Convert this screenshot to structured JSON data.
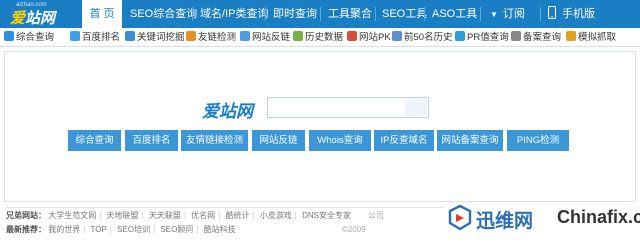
{
  "brand": {
    "domain": "aizhan.com",
    "name_part1": "爱",
    "name_part2": "站网"
  },
  "nav": {
    "home": "首 页",
    "items": [
      "SEO综合查询",
      "域名/IP类查询",
      "即时查询",
      "工具聚合",
      "SEO工具",
      "ASO工具"
    ],
    "subscribe": "订阅",
    "mobile": "手机版"
  },
  "tools": [
    {
      "label": "综合查询",
      "color": "#2d8fe0"
    },
    {
      "label": "百度排名",
      "color": "#3aa0e8"
    },
    {
      "label": "关键词挖掘",
      "color": "#3b8fd6"
    },
    {
      "label": "友链检测",
      "color": "#e3932c"
    },
    {
      "label": "网站反链",
      "color": "#4d9de0"
    },
    {
      "label": "历史数据",
      "color": "#7bb142"
    },
    {
      "label": "网站PK",
      "color": "#d84e3c"
    },
    {
      "label": "前50名历史",
      "color": "#5a8fd0"
    },
    {
      "label": "PR值查询",
      "color": "#2f9cd6"
    },
    {
      "label": "备案查询",
      "color": "#888888"
    },
    {
      "label": "模拟抓取",
      "color": "#e0a020"
    }
  ],
  "search": {
    "logo": "爱站网",
    "placeholder": "",
    "value": ""
  },
  "buttons": [
    "综合查询",
    "百度排名",
    "友情链接检测",
    "网站反链",
    "Whois查询",
    "IP反查域名",
    "网站备案查询",
    "PING检测"
  ],
  "footer": {
    "sister_label": "兄弟网站：",
    "sister_links": [
      "大学生范文网",
      "天地联盟",
      "天天联盟",
      "优名网",
      "酷统计",
      "小皮游戏",
      "DNS安全专家"
    ],
    "sister_tail": "公司",
    "latest_label": "最新推荐：",
    "latest_links": [
      "我的世界",
      "TOP",
      "SEO培训",
      "SEO顾问",
      "酷站科技"
    ],
    "copyright_fragment": "©2009"
  },
  "watermark": {
    "cn": "迅维网",
    "en": "Chinafix.com"
  },
  "colors": {
    "nav_bg": "#1a7ec5",
    "button": "#3b97d8",
    "brand_accent": "#ffd200"
  }
}
